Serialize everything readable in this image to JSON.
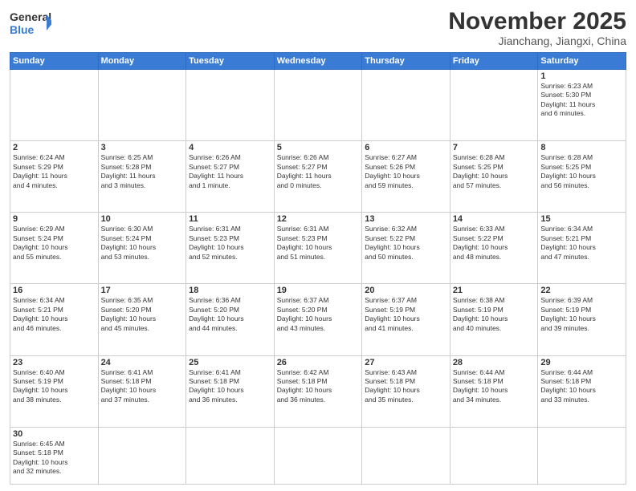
{
  "header": {
    "logo_general": "General",
    "logo_blue": "Blue",
    "month": "November 2025",
    "location": "Jianchang, Jiangxi, China"
  },
  "weekdays": [
    "Sunday",
    "Monday",
    "Tuesday",
    "Wednesday",
    "Thursday",
    "Friday",
    "Saturday"
  ],
  "weeks": [
    [
      {
        "day": "",
        "info": ""
      },
      {
        "day": "",
        "info": ""
      },
      {
        "day": "",
        "info": ""
      },
      {
        "day": "",
        "info": ""
      },
      {
        "day": "",
        "info": ""
      },
      {
        "day": "",
        "info": ""
      },
      {
        "day": "1",
        "info": "Sunrise: 6:23 AM\nSunset: 5:30 PM\nDaylight: 11 hours\nand 6 minutes."
      }
    ],
    [
      {
        "day": "2",
        "info": "Sunrise: 6:24 AM\nSunset: 5:29 PM\nDaylight: 11 hours\nand 4 minutes."
      },
      {
        "day": "3",
        "info": "Sunrise: 6:25 AM\nSunset: 5:28 PM\nDaylight: 11 hours\nand 3 minutes."
      },
      {
        "day": "4",
        "info": "Sunrise: 6:26 AM\nSunset: 5:27 PM\nDaylight: 11 hours\nand 1 minute."
      },
      {
        "day": "5",
        "info": "Sunrise: 6:26 AM\nSunset: 5:27 PM\nDaylight: 11 hours\nand 0 minutes."
      },
      {
        "day": "6",
        "info": "Sunrise: 6:27 AM\nSunset: 5:26 PM\nDaylight: 10 hours\nand 59 minutes."
      },
      {
        "day": "7",
        "info": "Sunrise: 6:28 AM\nSunset: 5:25 PM\nDaylight: 10 hours\nand 57 minutes."
      },
      {
        "day": "8",
        "info": "Sunrise: 6:28 AM\nSunset: 5:25 PM\nDaylight: 10 hours\nand 56 minutes."
      }
    ],
    [
      {
        "day": "9",
        "info": "Sunrise: 6:29 AM\nSunset: 5:24 PM\nDaylight: 10 hours\nand 55 minutes."
      },
      {
        "day": "10",
        "info": "Sunrise: 6:30 AM\nSunset: 5:24 PM\nDaylight: 10 hours\nand 53 minutes."
      },
      {
        "day": "11",
        "info": "Sunrise: 6:31 AM\nSunset: 5:23 PM\nDaylight: 10 hours\nand 52 minutes."
      },
      {
        "day": "12",
        "info": "Sunrise: 6:31 AM\nSunset: 5:23 PM\nDaylight: 10 hours\nand 51 minutes."
      },
      {
        "day": "13",
        "info": "Sunrise: 6:32 AM\nSunset: 5:22 PM\nDaylight: 10 hours\nand 50 minutes."
      },
      {
        "day": "14",
        "info": "Sunrise: 6:33 AM\nSunset: 5:22 PM\nDaylight: 10 hours\nand 48 minutes."
      },
      {
        "day": "15",
        "info": "Sunrise: 6:34 AM\nSunset: 5:21 PM\nDaylight: 10 hours\nand 47 minutes."
      }
    ],
    [
      {
        "day": "16",
        "info": "Sunrise: 6:34 AM\nSunset: 5:21 PM\nDaylight: 10 hours\nand 46 minutes."
      },
      {
        "day": "17",
        "info": "Sunrise: 6:35 AM\nSunset: 5:20 PM\nDaylight: 10 hours\nand 45 minutes."
      },
      {
        "day": "18",
        "info": "Sunrise: 6:36 AM\nSunset: 5:20 PM\nDaylight: 10 hours\nand 44 minutes."
      },
      {
        "day": "19",
        "info": "Sunrise: 6:37 AM\nSunset: 5:20 PM\nDaylight: 10 hours\nand 43 minutes."
      },
      {
        "day": "20",
        "info": "Sunrise: 6:37 AM\nSunset: 5:19 PM\nDaylight: 10 hours\nand 41 minutes."
      },
      {
        "day": "21",
        "info": "Sunrise: 6:38 AM\nSunset: 5:19 PM\nDaylight: 10 hours\nand 40 minutes."
      },
      {
        "day": "22",
        "info": "Sunrise: 6:39 AM\nSunset: 5:19 PM\nDaylight: 10 hours\nand 39 minutes."
      }
    ],
    [
      {
        "day": "23",
        "info": "Sunrise: 6:40 AM\nSunset: 5:19 PM\nDaylight: 10 hours\nand 38 minutes."
      },
      {
        "day": "24",
        "info": "Sunrise: 6:41 AM\nSunset: 5:18 PM\nDaylight: 10 hours\nand 37 minutes."
      },
      {
        "day": "25",
        "info": "Sunrise: 6:41 AM\nSunset: 5:18 PM\nDaylight: 10 hours\nand 36 minutes."
      },
      {
        "day": "26",
        "info": "Sunrise: 6:42 AM\nSunset: 5:18 PM\nDaylight: 10 hours\nand 36 minutes."
      },
      {
        "day": "27",
        "info": "Sunrise: 6:43 AM\nSunset: 5:18 PM\nDaylight: 10 hours\nand 35 minutes."
      },
      {
        "day": "28",
        "info": "Sunrise: 6:44 AM\nSunset: 5:18 PM\nDaylight: 10 hours\nand 34 minutes."
      },
      {
        "day": "29",
        "info": "Sunrise: 6:44 AM\nSunset: 5:18 PM\nDaylight: 10 hours\nand 33 minutes."
      }
    ],
    [
      {
        "day": "30",
        "info": "Sunrise: 6:45 AM\nSunset: 5:18 PM\nDaylight: 10 hours\nand 32 minutes."
      },
      {
        "day": "",
        "info": ""
      },
      {
        "day": "",
        "info": ""
      },
      {
        "day": "",
        "info": ""
      },
      {
        "day": "",
        "info": ""
      },
      {
        "day": "",
        "info": ""
      },
      {
        "day": "",
        "info": ""
      }
    ]
  ]
}
